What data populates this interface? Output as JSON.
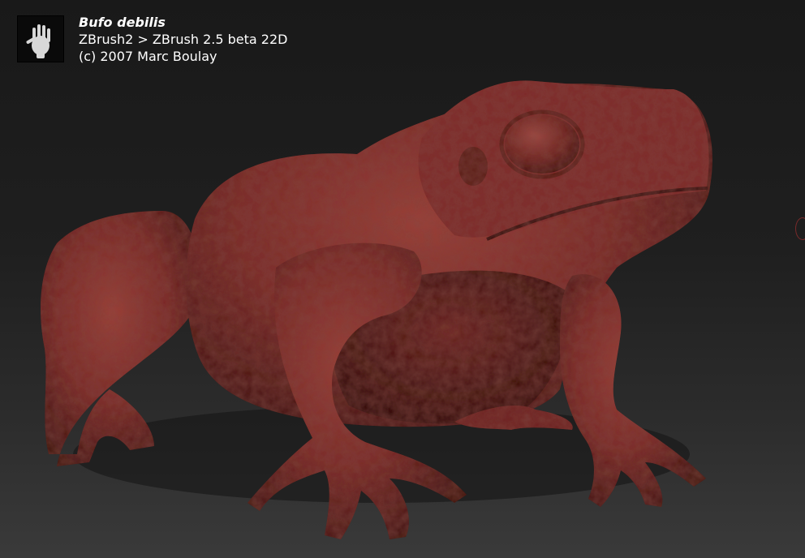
{
  "caption": {
    "title": "Bufo debilis",
    "software": "ZBrush2 > ZBrush 2.5 beta 22D",
    "copyright": "(c) 2007 Marc Boulay"
  },
  "logo": {
    "icon": "hand-print-icon"
  },
  "render": {
    "subject": "toad-sculpt",
    "colors": {
      "clay": "#7a2a28",
      "clay_light": "#9a4038",
      "clay_dark": "#3e1210",
      "background_top": "#191919",
      "background_bottom": "#3a3a3a"
    }
  }
}
